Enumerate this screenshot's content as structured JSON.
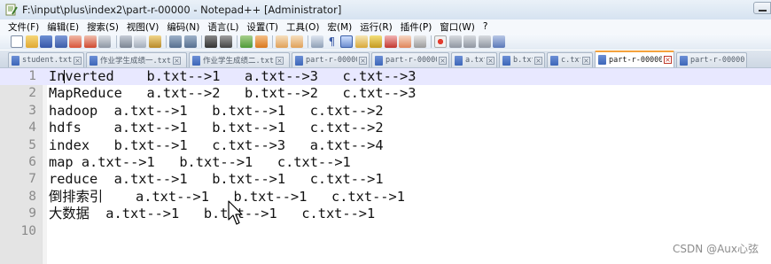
{
  "window": {
    "title": "F:\\input\\plus\\index2\\part-r-00000 - Notepad++ [Administrator]"
  },
  "menu": {
    "items": [
      {
        "label": "文件(F)"
      },
      {
        "label": "编辑(E)"
      },
      {
        "label": "搜索(S)"
      },
      {
        "label": "视图(V)"
      },
      {
        "label": "编码(N)"
      },
      {
        "label": "语言(L)"
      },
      {
        "label": "设置(T)"
      },
      {
        "label": "工具(O)"
      },
      {
        "label": "宏(M)"
      },
      {
        "label": "运行(R)"
      },
      {
        "label": "插件(P)"
      },
      {
        "label": "窗口(W)"
      },
      {
        "label": "?"
      }
    ]
  },
  "tabs": [
    {
      "label": "student.txt",
      "active": false
    },
    {
      "label": "作业学生成绩一.txt",
      "active": false
    },
    {
      "label": "作业学生成绩二.txt",
      "active": false
    },
    {
      "label": "part-r-00000",
      "active": false
    },
    {
      "label": "part-r-00000",
      "active": false
    },
    {
      "label": "a.txt",
      "active": false
    },
    {
      "label": "b.txt",
      "active": false
    },
    {
      "label": "c.txt",
      "active": false
    },
    {
      "label": "part-r-00000",
      "active": true
    },
    {
      "label": "part-r-00000",
      "active": false
    }
  ],
  "editor": {
    "current_line": 1,
    "lines": [
      {
        "num": "1",
        "text": "Inverted    b.txt-->1   a.txt-->3   c.txt-->3"
      },
      {
        "num": "2",
        "text": "MapReduce   a.txt-->2   b.txt-->2   c.txt-->3"
      },
      {
        "num": "3",
        "text": "hadoop  a.txt-->1   b.txt-->1   c.txt-->2"
      },
      {
        "num": "4",
        "text": "hdfs    a.txt-->1   b.txt-->1   c.txt-->2"
      },
      {
        "num": "5",
        "text": "index   b.txt-->1   c.txt-->3   a.txt-->4"
      },
      {
        "num": "6",
        "text": "map a.txt-->1   b.txt-->1   c.txt-->1"
      },
      {
        "num": "7",
        "text": "reduce  a.txt-->1   b.txt-->1   c.txt-->1"
      },
      {
        "num": "8",
        "text": "倒排索引    a.txt-->1   b.txt-->1   c.txt-->1"
      },
      {
        "num": "9",
        "text": "大数据  a.txt-->1   b.txt-->1   c.txt-->1"
      },
      {
        "num": "10",
        "text": ""
      }
    ]
  },
  "watermark": "CSDN @Aux心弦",
  "colors": {
    "current_line_bg": "#e8e8ff",
    "gutter_bg": "#e4e4e4",
    "active_tab_accent": "#f4a23c"
  }
}
